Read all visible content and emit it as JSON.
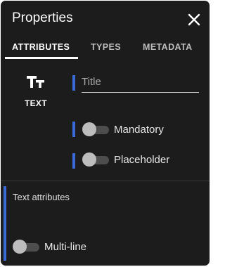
{
  "dialog": {
    "title": "Properties",
    "close_icon": "close-icon"
  },
  "tabs": [
    {
      "label": "ATTRIBUTES",
      "active": true
    },
    {
      "label": "TYPES",
      "active": false
    },
    {
      "label": "METADATA",
      "active": false
    }
  ],
  "field_type": {
    "icon": "text-type-icon",
    "label": "TEXT"
  },
  "title_input": {
    "placeholder": "Title",
    "value": ""
  },
  "toggles": {
    "mandatory": {
      "label": "Mandatory",
      "on": false
    },
    "placeholder": {
      "label": "Placeholder",
      "on": false
    },
    "multiline": {
      "label": "Multi-line",
      "on": false
    }
  },
  "section": {
    "label": "Text attributes"
  },
  "colors": {
    "panel_bg": "#1c1c1c",
    "accent": "#3a6ad8"
  }
}
